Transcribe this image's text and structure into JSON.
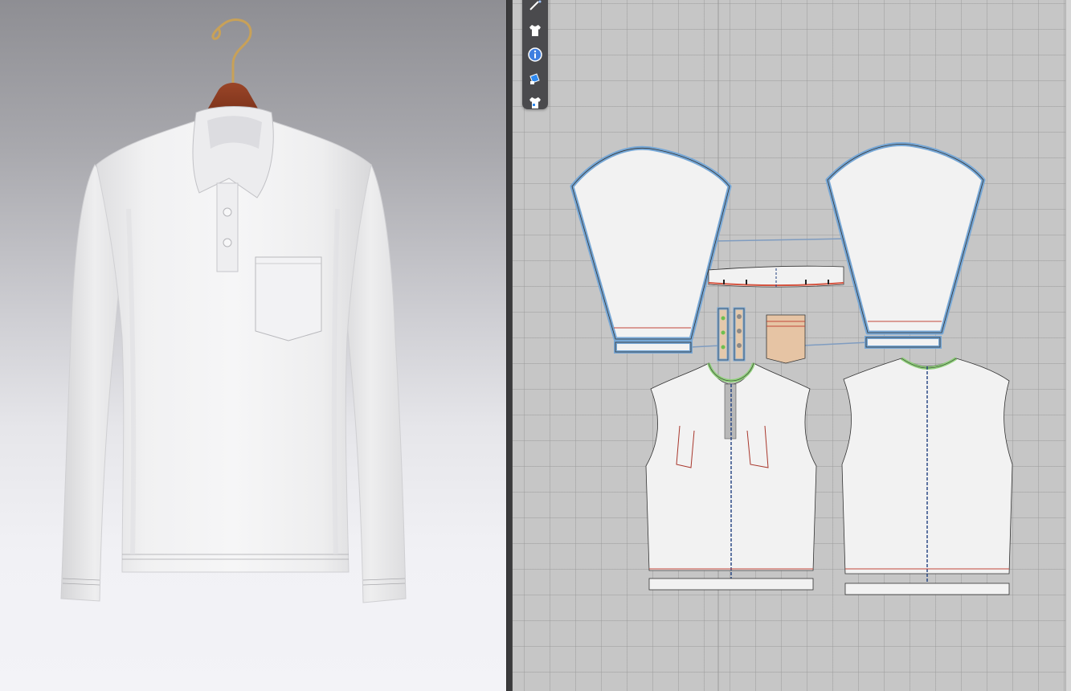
{
  "app": {
    "views": [
      "3d-garment-view",
      "2d-pattern-view"
    ]
  },
  "toolbar": {
    "tools": [
      {
        "icon": "simulation-wand-icon"
      },
      {
        "icon": "garment-shirt-icon"
      },
      {
        "icon": "info-icon"
      },
      {
        "icon": "texture-layer-icon"
      },
      {
        "icon": "avatar-shirt-icon"
      }
    ]
  },
  "garment": {
    "type": "long-sleeve-polo-shirt",
    "fabric_color": "#efefef",
    "hanger_color": "#8a3a20",
    "hook_color": "#c8a158",
    "buttons_visible": 2,
    "has_chest_pocket": true
  },
  "patterns": {
    "pieces": [
      {
        "name": "left-sleeve"
      },
      {
        "name": "right-sleeve"
      },
      {
        "name": "collar"
      },
      {
        "name": "placket-left"
      },
      {
        "name": "placket-right"
      },
      {
        "name": "pocket"
      },
      {
        "name": "front-body"
      },
      {
        "name": "back-body"
      },
      {
        "name": "left-cuff"
      },
      {
        "name": "right-cuff"
      }
    ],
    "colors": {
      "selected_outline": "#76a7d6",
      "piece_fill": "#f2f2f2",
      "seam_line": "#c2473a",
      "pocket_fill": "#e6c4a4",
      "rib_green": "#8fd17a",
      "grid_bg": "#c6c6c6"
    }
  }
}
